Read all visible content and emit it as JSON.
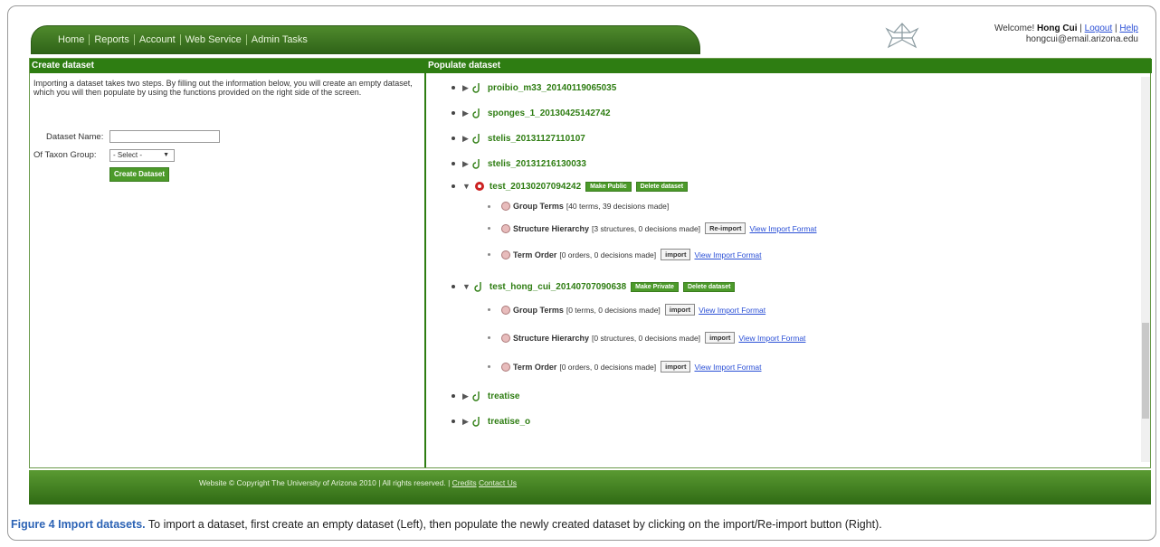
{
  "nav": {
    "items": [
      "Home",
      "Reports",
      "Account",
      "Web Service",
      "Admin Tasks"
    ]
  },
  "welcome": {
    "prefix": "Welcome!",
    "user": "Hong Cui",
    "sep1": "|",
    "logout": "Logout",
    "sep2": "|",
    "help": "Help",
    "email": "hongcui@email.arizona.edu"
  },
  "left": {
    "title": "Create dataset",
    "intro": "Importing a dataset takes two steps. By filling out the information below, you will create an empty dataset, which you will then populate by using the functions provided on the right side of the screen.",
    "name_label": "Dataset Name:",
    "name_value": "",
    "group_label": "Of Taxon Group:",
    "group_value": "- Select -",
    "create_button": "Create Dataset"
  },
  "right": {
    "title": "Populate dataset",
    "datasets": [
      {
        "name": "proibio_m33_20140119065035"
      },
      {
        "name": "sponges_1_20130425142742"
      },
      {
        "name": "stelis_20131127110107"
      },
      {
        "name": "stelis_20131216130033"
      }
    ],
    "expanded1": {
      "name": "test_20130207094242",
      "btn1": "Make Public",
      "btn2": "Delete dataset",
      "items": [
        {
          "label": "Group Terms",
          "detail": "[40 terms, 39 decisions made]"
        },
        {
          "label": "Structure Hierarchy",
          "detail": "[3 structures, 0 decisions made]",
          "button": "Re-import",
          "link": "View Import Format"
        },
        {
          "label": "Term Order",
          "detail": "[0 orders, 0 decisions made]",
          "button": "import",
          "link": "View Import Format"
        }
      ]
    },
    "expanded2": {
      "name": "test_hong_cui_20140707090638",
      "btn1": "Make Private",
      "btn2": "Delete dataset",
      "items": [
        {
          "label": "Group Terms",
          "detail": "[0 terms, 0 decisions made]",
          "button": "import",
          "link": "View Import Format"
        },
        {
          "label": "Structure Hierarchy",
          "detail": "[0 structures, 0 decisions made]",
          "button": "import",
          "link": "View Import Format"
        },
        {
          "label": "Term Order",
          "detail": "[0 orders, 0 decisions made]",
          "button": "import",
          "link": "View Import Format"
        }
      ]
    },
    "tail": [
      {
        "name": "treatise"
      },
      {
        "name": "treatise_o"
      }
    ]
  },
  "footer": {
    "text": "Website © Copyright The University of Arizona 2010 | All rights reserved. |",
    "credits": "Credits",
    "contact": "Contact Us"
  },
  "caption": {
    "bold": "Figure 4 Import datasets.",
    "text": " To import a dataset, first create an empty dataset (Left), then populate the newly created dataset by clicking on the import/Re-import button (Right)."
  },
  "colors": {
    "brand_green": "#2e7d12",
    "link_blue": "#2a4fd6",
    "caption_blue": "#2c63b5"
  }
}
